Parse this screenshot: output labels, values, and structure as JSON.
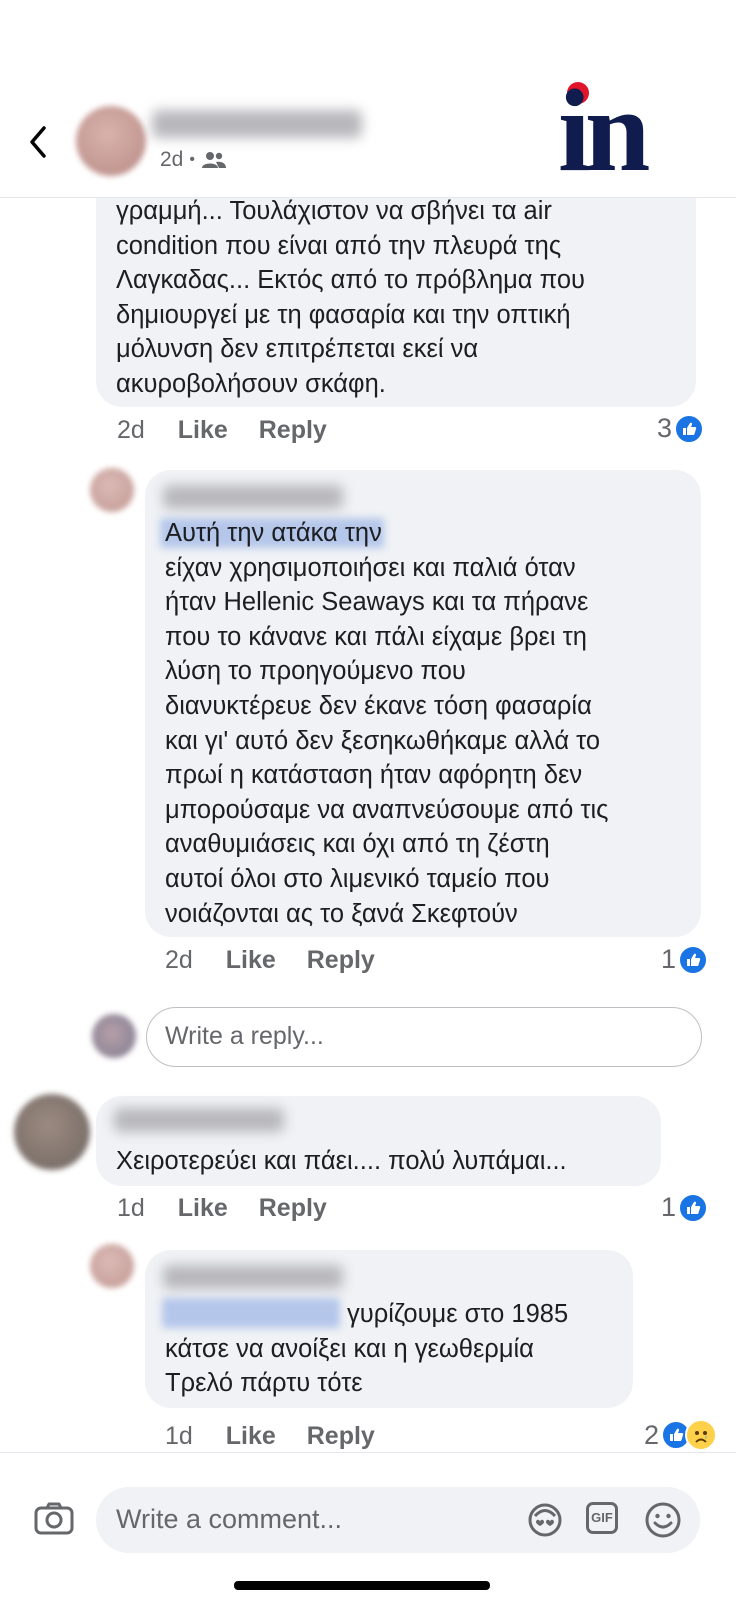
{
  "header": {
    "post_time": "2d",
    "logo_text": "in",
    "brand_color": "#0f1c4d",
    "dot_color": "#e0142a"
  },
  "comments": [
    {
      "text": "γραμμή... Τουλάχιστον να σβήνει τα air\ncondition που είναι από την πλευρά της\nΛαγκαδας... Εκτός από το πρόβλημα που\nδημιουργεί με τη φασαρία και την οπτική\nμόλυνση δεν επιτρέπεται εκεί να\nακυροβολήσουν σκάφη.",
      "time": "2d",
      "like": "Like",
      "reply": "Reply",
      "reactions": "3"
    },
    {
      "text": "Αυτή την ατάκα την\nείχαν χρησιμοποιήσει και παλιά όταν\nήταν Hellenic Seaways και τα πήρανε\nπου το κάνανε και πάλι είχαμε βρει τη\nλύση το προηγούμενο που\nδιανυκτέρευε δεν έκανε τόση φασαρία\nκαι γι' αυτό δεν ξεσηκωθήκαμε αλλά το\nπρωί η κατάσταση ήταν αφόρητη δεν\nμπορούσαμε να αναπνεύσουμε από τις\nαναθυμιάσεις και όχι από τη ζέστη\nαυτοί όλοι στο λιμενικό ταμείο που\nνοιάζονται ας το ξανά Σκεφτούν",
      "time": "2d",
      "like": "Like",
      "reply": "Reply",
      "reactions": "1"
    },
    {
      "text": "Χειροτερεύει και πάει.... πολύ λυπάμαι...",
      "time": "1d",
      "like": "Like",
      "reply": "Reply",
      "reactions": "1"
    },
    {
      "text": "γυρίζουμε στο 1985\nκάτσε να ανοίξει και η γεωθερμία\nΤρελό πάρτυ τότε",
      "time": "1d",
      "like": "Like",
      "reply": "Reply",
      "reactions": "2"
    }
  ],
  "reply_box": {
    "placeholder": "Write a reply..."
  },
  "comment_bar": {
    "placeholder": "Write a comment...",
    "gif_label": "GIF"
  },
  "colors": {
    "like_blue": "#1b74e4",
    "bubble_bg": "#f0f2f5",
    "meta_gray": "#65676b"
  },
  "icons": [
    "chevron-left-icon",
    "friends-icon",
    "like-icon",
    "sad-icon",
    "camera-icon",
    "avatar-sticker-icon",
    "gif-icon",
    "emoji-icon"
  ]
}
